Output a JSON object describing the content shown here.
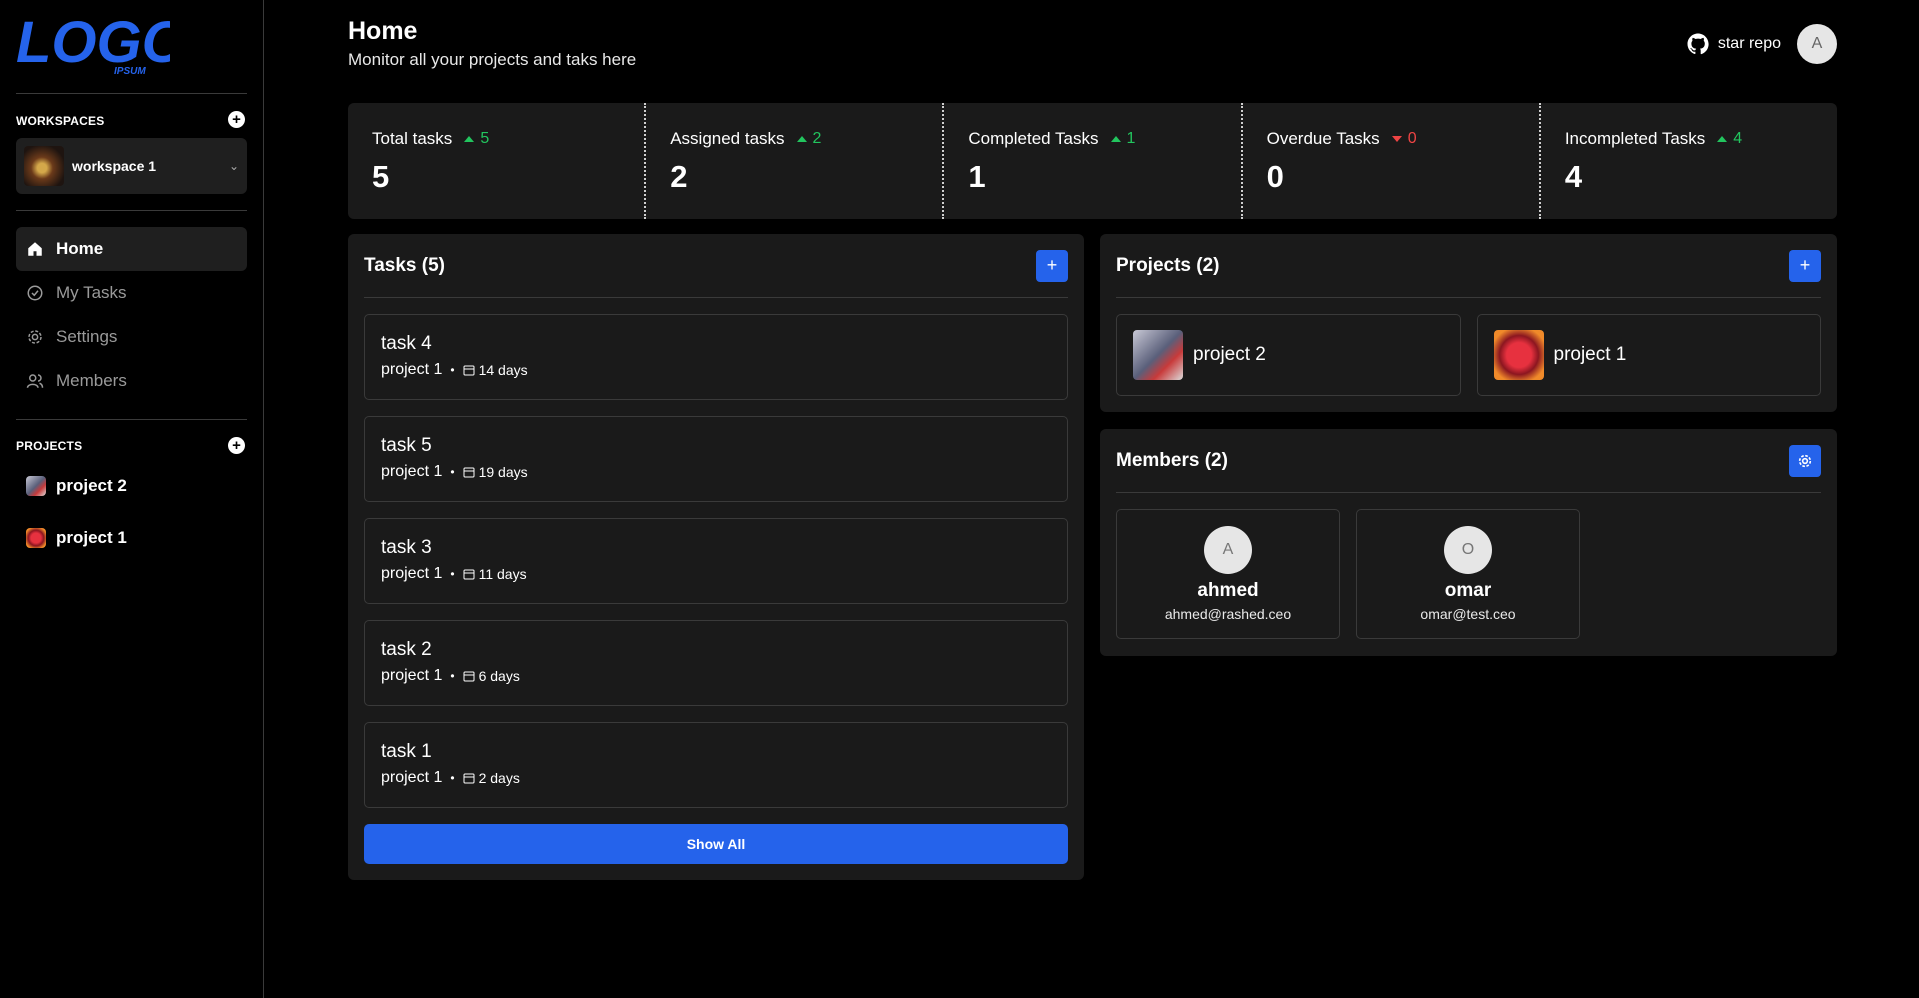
{
  "logo": {
    "text": "LOGO",
    "sub": "IPSUM"
  },
  "sidebar": {
    "workspaces_label": "WORKSPACES",
    "workspace_name": "workspace 1",
    "nav": [
      {
        "label": "Home",
        "icon": "home-icon"
      },
      {
        "label": "My Tasks",
        "icon": "check-circle-icon"
      },
      {
        "label": "Settings",
        "icon": "gear-icon"
      },
      {
        "label": "Members",
        "icon": "users-icon"
      }
    ],
    "projects_label": "PROJECTS",
    "projects": [
      {
        "label": "project 2"
      },
      {
        "label": "project 1"
      }
    ]
  },
  "header": {
    "title": "Home",
    "subtitle": "Monitor all your projects and taks here",
    "star_repo": "star repo",
    "avatar_initial": "A"
  },
  "stats": [
    {
      "label": "Total tasks",
      "change": "5",
      "direction": "up",
      "value": "5"
    },
    {
      "label": "Assigned tasks",
      "change": "2",
      "direction": "up",
      "value": "2"
    },
    {
      "label": "Completed Tasks",
      "change": "1",
      "direction": "up",
      "value": "1"
    },
    {
      "label": "Overdue Tasks",
      "change": "0",
      "direction": "down",
      "value": "0"
    },
    {
      "label": "Incompleted Tasks",
      "change": "4",
      "direction": "up",
      "value": "4"
    }
  ],
  "tasks": {
    "title": "Tasks (5)",
    "items": [
      {
        "name": "task 4",
        "project": "project 1",
        "days": "14 days"
      },
      {
        "name": "task 5",
        "project": "project 1",
        "days": "19 days"
      },
      {
        "name": "task 3",
        "project": "project 1",
        "days": "11 days"
      },
      {
        "name": "task 2",
        "project": "project 1",
        "days": "6 days"
      },
      {
        "name": "task 1",
        "project": "project 1",
        "days": "2 days"
      }
    ],
    "show_all": "Show All"
  },
  "projects": {
    "title": "Projects (2)",
    "items": [
      {
        "name": "project 2"
      },
      {
        "name": "project 1"
      }
    ]
  },
  "members": {
    "title": "Members (2)",
    "items": [
      {
        "initial": "A",
        "name": "ahmed",
        "email": "ahmed@rashed.ceo"
      },
      {
        "initial": "O",
        "name": "omar",
        "email": "omar@test.ceo"
      }
    ]
  },
  "colors": {
    "accent": "#2563eb",
    "up": "#22c55e",
    "down": "#ef4444",
    "panel": "#1a1a1a"
  }
}
